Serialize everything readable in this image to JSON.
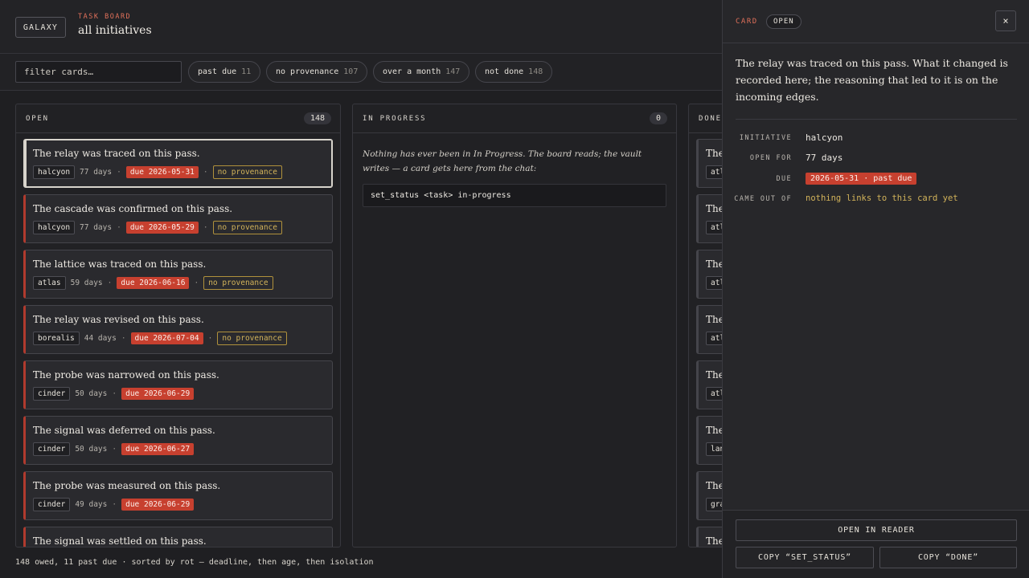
{
  "header": {
    "logo": "GALAXY",
    "eyebrow": "TASK BOARD",
    "title": "all initiatives"
  },
  "filters": {
    "search_placeholder": "filter cards…",
    "chips": [
      {
        "label": "past due",
        "count": "11"
      },
      {
        "label": "no provenance",
        "count": "107"
      },
      {
        "label": "over a month",
        "count": "147"
      },
      {
        "label": "not done",
        "count": "148"
      }
    ]
  },
  "columns": {
    "open": {
      "title": "OPEN",
      "count": "148",
      "cards": [
        {
          "title": "The relay was traced on this pass.",
          "tag": "halcyon",
          "days": "77 days",
          "due": "due 2026-05-31",
          "prov": "no provenance"
        },
        {
          "title": "The cascade was confirmed on this pass.",
          "tag": "halcyon",
          "days": "77 days",
          "due": "due 2026-05-29",
          "prov": "no provenance"
        },
        {
          "title": "The lattice was traced on this pass.",
          "tag": "atlas",
          "days": "59 days",
          "due": "due 2026-06-16",
          "prov": "no provenance"
        },
        {
          "title": "The relay was revised on this pass.",
          "tag": "borealis",
          "days": "44 days",
          "due": "due 2026-07-04",
          "prov": "no provenance"
        },
        {
          "title": "The probe was narrowed on this pass.",
          "tag": "cinder",
          "days": "50 days",
          "due": "due 2026-06-29"
        },
        {
          "title": "The signal was deferred on this pass.",
          "tag": "cinder",
          "days": "50 days",
          "due": "due 2026-06-27"
        },
        {
          "title": "The probe was measured on this pass.",
          "tag": "cinder",
          "days": "49 days",
          "due": "due 2026-06-29"
        },
        {
          "title": "The signal was settled on this pass."
        }
      ]
    },
    "in_progress": {
      "title": "IN PROGRESS",
      "count": "0",
      "empty_note": "Nothing has ever been in In Progress. The board reads; the vault writes — a card gets here from the chat:",
      "command": "set_status <task> in-progress"
    },
    "done": {
      "title": "DONE",
      "cards": [
        {
          "title": "The",
          "tag": "atl"
        },
        {
          "title": "The",
          "tag": "atl"
        },
        {
          "title": "The",
          "tag": "atl"
        },
        {
          "title": "The",
          "tag": "atl"
        },
        {
          "title": "The",
          "tag": "atl"
        },
        {
          "title": "The",
          "tag": "lan"
        },
        {
          "title": "The",
          "tag": "gra"
        },
        {
          "title": "The"
        }
      ]
    }
  },
  "status_bar": "148 owed, 11 past due · sorted by rot — deadline, then age, then isolation",
  "panel": {
    "label": "CARD",
    "state": "OPEN",
    "close": "×",
    "description": "The relay was traced on this pass. What it changed is recorded here; the reasoning that led to it is on the incoming edges.",
    "props": {
      "initiative_label": "INITIATIVE",
      "initiative": "halcyon",
      "open_for_label": "OPEN FOR",
      "open_for": "77 days",
      "due_label": "DUE",
      "due": "2026-05-31 · past due",
      "came_out_of_label": "CAME OUT OF",
      "came_out_of": "nothing links to this card yet"
    },
    "buttons": {
      "open_reader": "OPEN IN READER",
      "copy_status": "COPY “SET_STATUS”",
      "copy_done": "COPY “DONE”"
    }
  }
}
